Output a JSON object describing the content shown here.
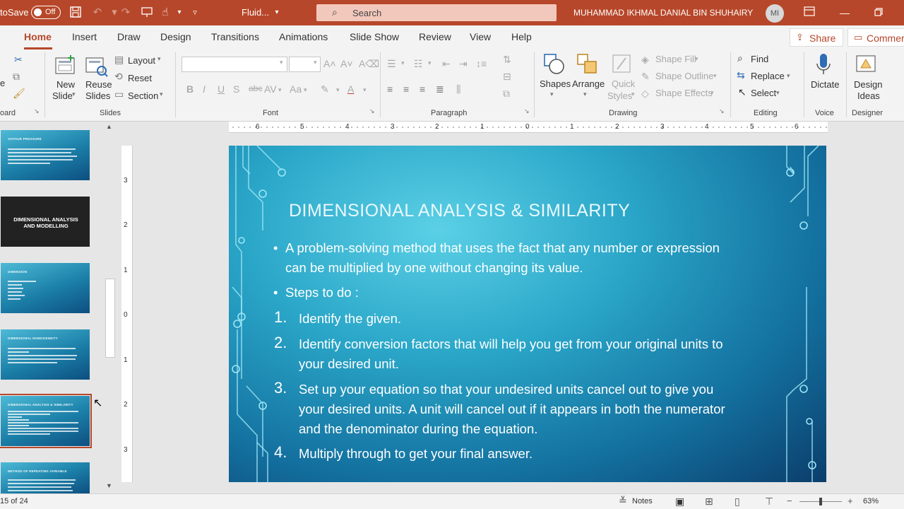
{
  "titlebar": {
    "autosave_label": "toSave",
    "toggle_label": "Off",
    "filename": "Fluid...",
    "search_placeholder": "Search",
    "username": "MUHAMMAD IKHMAL DANIAL BIN SHUHAIRY",
    "avatar_initials": "MI"
  },
  "tabs": [
    "Home",
    "Insert",
    "Draw",
    "Design",
    "Transitions",
    "Animations",
    "Slide Show",
    "Review",
    "View",
    "Help"
  ],
  "active_tab": "Home",
  "share_label": "Share",
  "comments_label": "Commer",
  "ribbon": {
    "clipboard": {
      "label": "oard",
      "paste_stub": "e"
    },
    "slides": {
      "label": "Slides",
      "new_slide": [
        "New",
        "Slide"
      ],
      "reuse_slides": [
        "Reuse",
        "Slides"
      ],
      "layout": "Layout",
      "reset": "Reset",
      "section": "Section"
    },
    "font": {
      "label": "Font",
      "bold": "B",
      "italic": "I",
      "underline": "U",
      "strike": "S",
      "spacing": "AV",
      "case": "Aa"
    },
    "paragraph": {
      "label": "Paragraph"
    },
    "drawing": {
      "label": "Drawing",
      "shapes": "Shapes",
      "arrange": "Arrange",
      "quick_styles": [
        "Quick",
        "Styles"
      ],
      "shape_fill": "Shape Fill",
      "shape_outline": "Shape Outline",
      "shape_effects": "Shape Effects"
    },
    "editing": {
      "label": "Editing",
      "find": "Find",
      "replace": "Replace",
      "select": "Select"
    },
    "voice": {
      "label": "Voice",
      "dictate": "Dictate"
    },
    "designer": {
      "label": "Designer",
      "design_ideas": [
        "Design",
        "Ideas"
      ]
    }
  },
  "thumbnails": [
    {
      "title": "VAPOUR PRESSURE",
      "style": "blue",
      "lines": 5,
      "selected": false
    },
    {
      "title": "DIMENSIONAL ANALYSIS AND MODELLING",
      "style": "dark",
      "lines": 0,
      "selected": false
    },
    {
      "title": "DIMENSION",
      "style": "blue",
      "lines": 6,
      "selected": false
    },
    {
      "title": "DIMENSIONAL HOMOGENEITY",
      "style": "blue",
      "lines": 5,
      "selected": false
    },
    {
      "title": "DIMENSIONAL ANALYSIS & SIMILARITY",
      "style": "blue",
      "lines": 9,
      "selected": true
    },
    {
      "title": "METHOD OF REPEATING VARIABLE",
      "style": "blue",
      "lines": 5,
      "selected": false
    }
  ],
  "ruler": {
    "h": [
      "6",
      "5",
      "4",
      "3",
      "2",
      "1",
      "0",
      "1",
      "2",
      "3",
      "4",
      "5",
      "6"
    ],
    "v": [
      "3",
      "2",
      "1",
      "0",
      "1",
      "2",
      "3"
    ]
  },
  "slide": {
    "title": "DIMENSIONAL ANALYSIS & SIMILARITY",
    "bullets": [
      [
        "A problem-solving method that uses the fact that any number or expression",
        "can be multiplied by one without changing its value."
      ],
      [
        "Steps to do :"
      ]
    ],
    "steps": [
      {
        "num": "1.",
        "lines": [
          "Identify the given."
        ]
      },
      {
        "num": "2.",
        "lines": [
          "Identify conversion factors that will help you get from your original units to",
          "your desired unit."
        ]
      },
      {
        "num": "3.",
        "lines": [
          "Set up your equation so that your undesired units cancel out to give you",
          "your desired units. A unit will cancel out if it appears in both the numerator",
          "and the denominator during the equation."
        ]
      },
      {
        "num": "4.",
        "lines": [
          "Multiply through to get your final answer."
        ]
      }
    ]
  },
  "status": {
    "slide_counter": "15 of 24",
    "notes": "Notes",
    "zoom": "63%"
  },
  "colors": {
    "accent": "#b7472a",
    "slide_dark": "#0b3d6b",
    "slide_light": "#5bd0e6"
  }
}
